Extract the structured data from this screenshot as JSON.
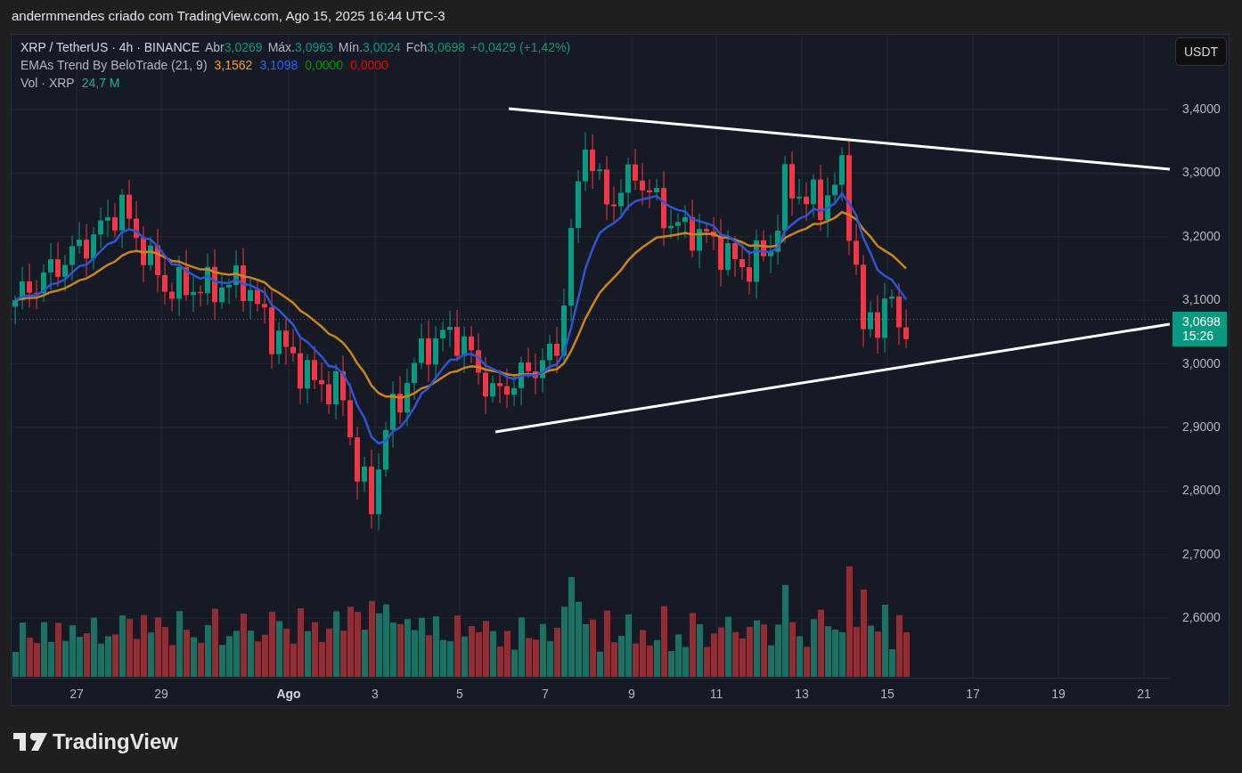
{
  "attribution": "andermmendes criado com TradingView.com, Ago 15, 2025 16:44 UTC-3",
  "legend": {
    "symbol": "XRP / TetherUS · 4h · BINANCE",
    "ohlc": [
      {
        "label": "Abr",
        "value": "3,0269"
      },
      {
        "label": "Máx.",
        "value": "3,0963"
      },
      {
        "label": "Mín.",
        "value": "3,0024"
      },
      {
        "label": "Fch",
        "value": "3,0698"
      }
    ],
    "change": "+0,0429 (+1,42%)",
    "indicator": {
      "name": "EMAs Trend By BeloTrade (21, 9)",
      "values": [
        {
          "value": "3,1562",
          "color": "#f59d1a"
        },
        {
          "value": "3,1098",
          "color": "#2962ff"
        },
        {
          "value": "0,0000",
          "color": "#089500"
        },
        {
          "value": "0,0000",
          "color": "#f20000"
        }
      ]
    },
    "volume": {
      "name": "Vol · XRP",
      "value": "24,7 M"
    }
  },
  "price_axis": {
    "currency": "USDT",
    "labels": [
      "3,4000",
      "3,3000",
      "3,2000",
      "3,1000",
      "3,0000",
      "2,9000",
      "2,8000",
      "2,7000",
      "2,6000"
    ],
    "last_price": {
      "value": "3,0698",
      "countdown": "15:26"
    }
  },
  "time_axis": [
    {
      "label": "27",
      "kind": "day"
    },
    {
      "label": "29",
      "kind": "day"
    },
    {
      "label": "Ago",
      "kind": "month"
    },
    {
      "label": "3",
      "kind": "day"
    },
    {
      "label": "5",
      "kind": "day"
    },
    {
      "label": "7",
      "kind": "day"
    },
    {
      "label": "9",
      "kind": "day"
    },
    {
      "label": "11",
      "kind": "day"
    },
    {
      "label": "13",
      "kind": "day"
    },
    {
      "label": "15",
      "kind": "day"
    },
    {
      "label": "17",
      "kind": "day"
    },
    {
      "label": "19",
      "kind": "day"
    },
    {
      "label": "21",
      "kind": "day"
    }
  ],
  "logo": "TradingView"
}
